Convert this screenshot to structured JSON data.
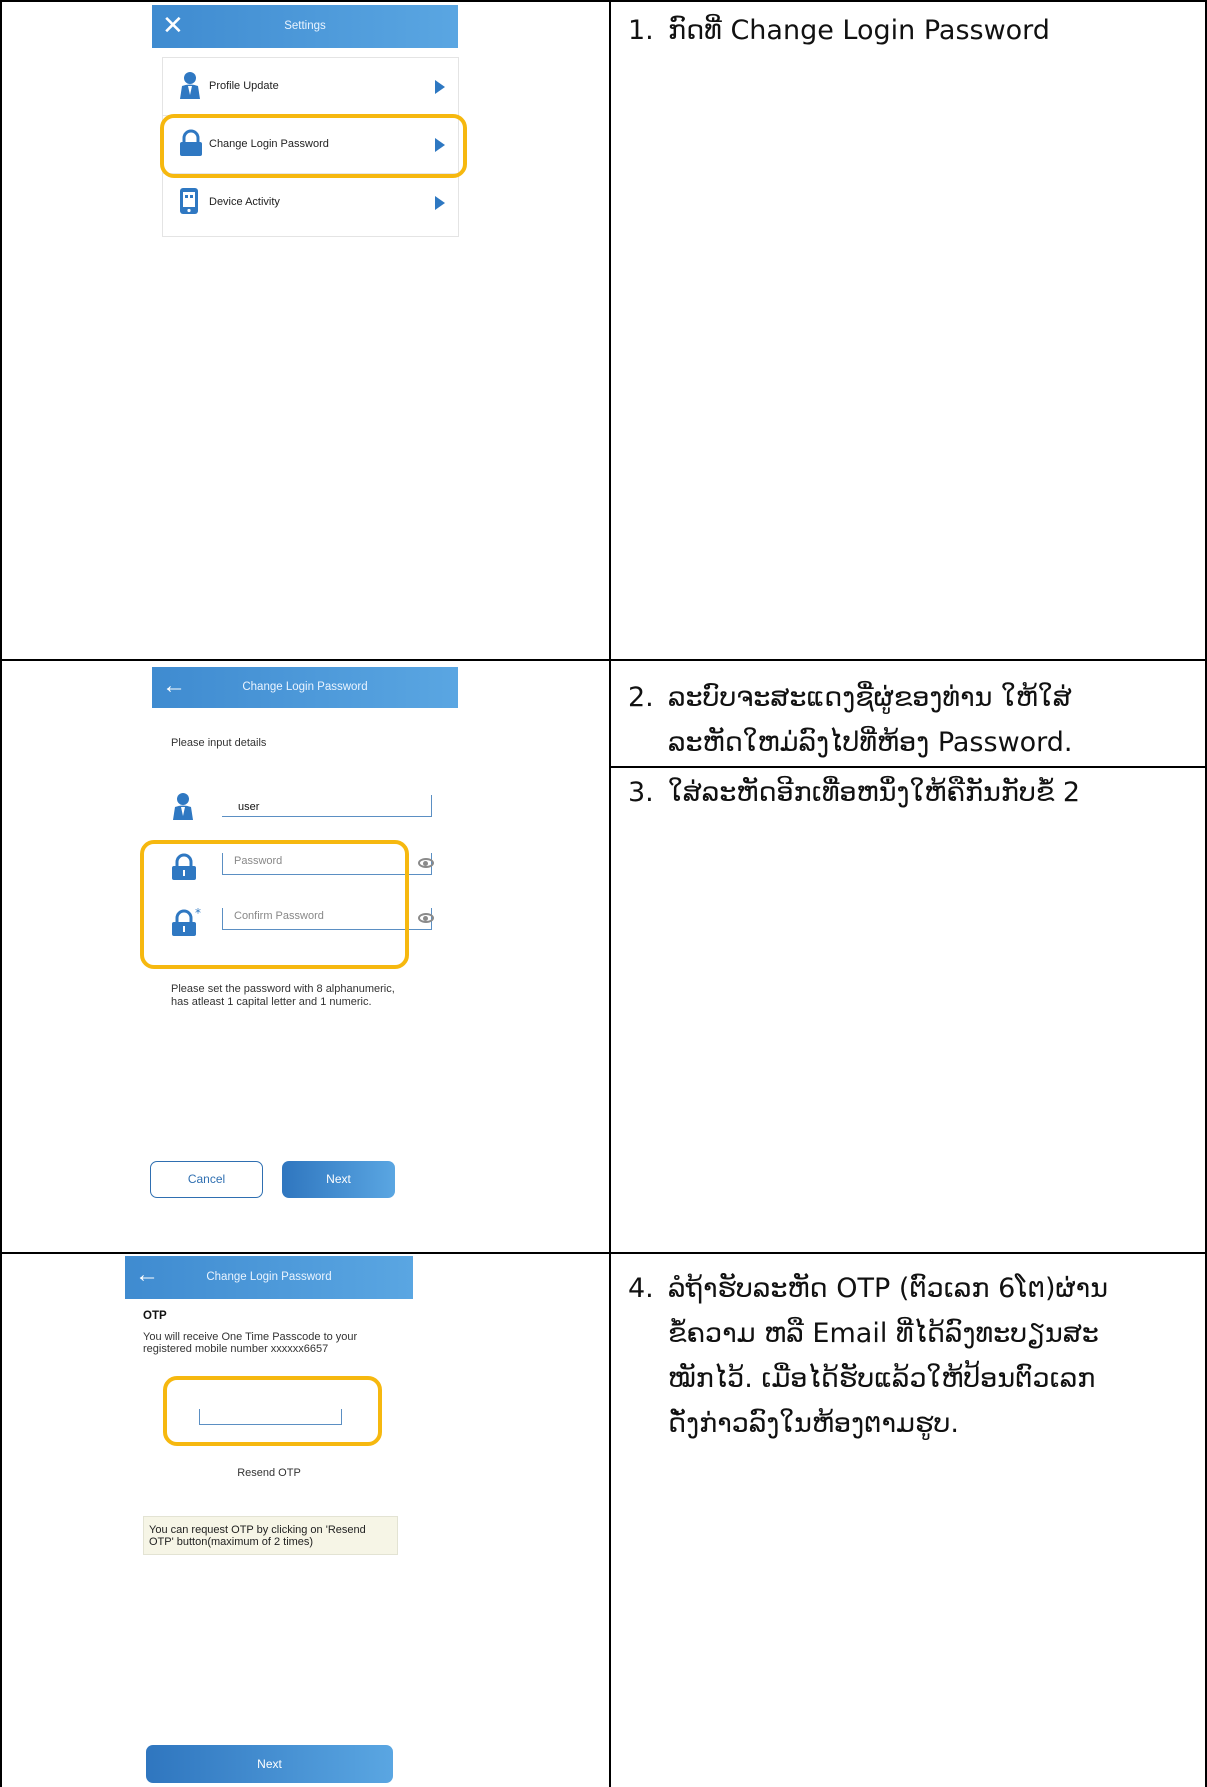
{
  "screen1": {
    "header_title": "Settings",
    "close_icon": "close-icon",
    "items": [
      {
        "label": "Profile Update",
        "icon": "user-icon"
      },
      {
        "label": "Change Login Password",
        "icon": "lock-icon"
      },
      {
        "label": "Device Activity",
        "icon": "device-icon"
      }
    ]
  },
  "screen2": {
    "header_title": "Change Login Password",
    "back_icon": "back-arrow-icon",
    "prompt": "Please input details",
    "username_value": "user",
    "password_placeholder": "Password",
    "confirm_placeholder": "Confirm Password",
    "hint": "Please set the password with 8 alphanumeric,\nhas atleast 1 capital letter and 1 numeric.",
    "cancel_label": "Cancel",
    "next_label": "Next"
  },
  "screen3": {
    "header_title": "Change Login Password",
    "back_icon": "back-arrow-icon",
    "otp_title": "OTP",
    "otp_note": "You will receive One Time Passcode to your\nregistered mobile number xxxxxx6657",
    "resend_label": "Resend OTP",
    "info": "You can request OTP by clicking on 'Resend\nOTP' button(maximum of 2 times)",
    "next_label": "Next"
  },
  "steps": [
    {
      "num": "1.",
      "text": "ກົດທີ່ Change Login Password"
    },
    {
      "num": "2.",
      "text": "ລະບົບຈະສະແດງຊື່ຜູ່ຂອງທ່ານ ໃຫ້ໃສ່\nລະຫັດໃຫມ່ລົງໄປທີ່ຫ້ອງ Password."
    },
    {
      "num": "3.",
      "text": "ໃສ່ລະຫັດອີກເທື່ອຫນຶ່ງໃຫ້ຄືກັນກັບຂໍ້ 2"
    },
    {
      "num": "4.",
      "text": "ລໍຖ້າຮັບລະຫັດ OTP (ຕົວເລກ 6ໂຕ)ຜ່ານ\nຂໍ້ຄວາມ ຫລື Email ທີ່ໄດ້ລົງທະບຽນສະ\nໝັກໄວ້. ເມື່ອໄດ້ຮັບແລ້ວໃຫ້ປ້ອນຕົວເລກ\nດັ່ງກ່າວລົງໃນຫ້ອງຕາມຮູບ."
    }
  ],
  "colors": {
    "accent_blue": "#3f8bd0",
    "highlight_yellow": "#f6b80f",
    "grid_black": "#000000"
  }
}
